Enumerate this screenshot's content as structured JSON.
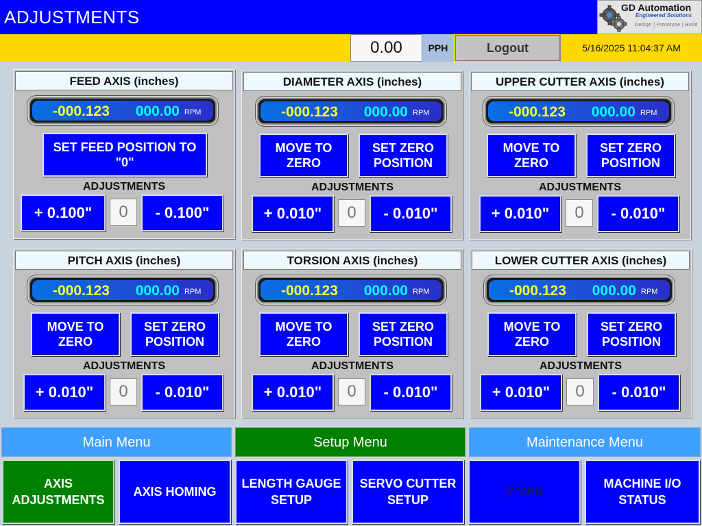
{
  "header": {
    "title": "ADJUSTMENTS",
    "logo_name": "GD Automation",
    "logo_sub": "Engineered Solutions",
    "logo_tag": "Design | Prototype | Build"
  },
  "status": {
    "pph_value": "0.00",
    "pph_unit": "PPH",
    "logout_label": "Logout",
    "datetime": "5/16/2025 11:04:37 AM"
  },
  "axes": [
    {
      "title": "FEED AXIS (inches)",
      "position": "-000.123",
      "speed": "0000.00",
      "speed_unit": "RPM",
      "action": "SET FEED POSITION TO \"0\"",
      "adj_label": "ADJUSTMENTS",
      "plus": "+ 0.100\"",
      "minus": "- 0.100\"",
      "step": "0"
    },
    {
      "title": "DIAMETER AXIS (inches)",
      "position": "-000.123",
      "speed": "0000.00",
      "speed_unit": "RPM",
      "action1": "MOVE TO ZERO",
      "action2": "SET ZERO POSITION",
      "adj_label": "ADJUSTMENTS",
      "plus": "+ 0.010\"",
      "minus": "- 0.010\"",
      "step": "0"
    },
    {
      "title": "UPPER CUTTER AXIS (inches)",
      "position": "-000.123",
      "speed": "0000.00",
      "speed_unit": "RPM",
      "action1": "MOVE TO ZERO",
      "action2": "SET ZERO POSITION",
      "adj_label": "ADJUSTMENTS",
      "plus": "+ 0.010\"",
      "minus": "- 0.010\"",
      "step": "0"
    },
    {
      "title": "PITCH AXIS (inches)",
      "position": "-000.123",
      "speed": "0000.00",
      "speed_unit": "RPM",
      "action1": "MOVE TO ZERO",
      "action2": "SET ZERO POSITION",
      "adj_label": "ADJUSTMENTS",
      "plus": "+ 0.010\"",
      "minus": "- 0.010\"",
      "step": "0"
    },
    {
      "title": "TORSION AXIS (inches)",
      "position": "-000.123",
      "speed": "0000.00",
      "speed_unit": "RPM",
      "action1": "MOVE TO ZERO",
      "action2": "SET ZERO POSITION",
      "adj_label": "ADJUSTMENTS",
      "plus": "+ 0.010\"",
      "minus": "- 0.010\"",
      "step": "0"
    },
    {
      "title": "LOWER CUTTER AXIS (inches)",
      "position": "-000.123",
      "speed": "0000.00",
      "speed_unit": "RPM",
      "action1": "MOVE TO ZERO",
      "action2": "SET ZERO POSITION",
      "adj_label": "ADJUSTMENTS",
      "plus": "+ 0.010\"",
      "minus": "- 0.010\"",
      "step": "0"
    }
  ],
  "menus": [
    {
      "label": "Main Menu"
    },
    {
      "label": "Setup Menu"
    },
    {
      "label": "Maintenance Menu"
    }
  ],
  "nav": [
    {
      "label": "AXIS ADJUSTMENTS"
    },
    {
      "label": "AXIS HOMING"
    },
    {
      "label": "LENGTH GAUGE SETUP"
    },
    {
      "label": "SERVO CUTTER SETUP"
    },
    {
      "label": "[SPARE]"
    },
    {
      "label": "MACHINE I/O STATUS"
    }
  ],
  "colors": {
    "title_bar": "#0000ff",
    "status_bar": "#ffd800",
    "button_blue": "#0000ff",
    "active_green": "#008000",
    "menu_blue": "#3fa0ff",
    "position_text": "#ffff33",
    "speed_text": "#00ffff"
  }
}
